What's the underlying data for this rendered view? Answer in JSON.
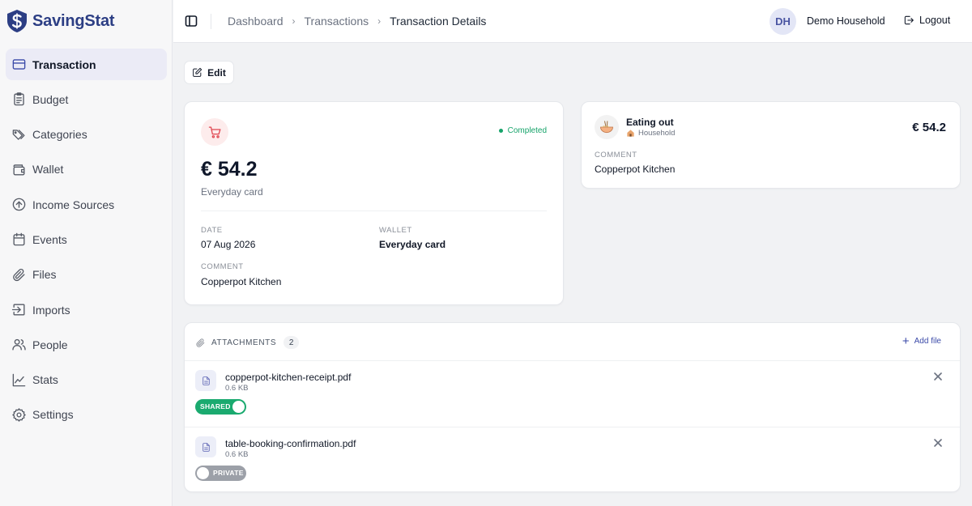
{
  "app": {
    "name": "SavingStat",
    "brand_color": "#2c3e84",
    "accent_color": "#3b4aa8"
  },
  "sidebar": {
    "items": [
      {
        "label": "Transaction",
        "icon": "credit-card-icon",
        "active": true
      },
      {
        "label": "Budget",
        "icon": "clipboard-icon"
      },
      {
        "label": "Categories",
        "icon": "tags-icon"
      },
      {
        "label": "Wallet",
        "icon": "wallet-icon"
      },
      {
        "label": "Income Sources",
        "icon": "arrow-up-circle-icon"
      },
      {
        "label": "Events",
        "icon": "calendar-icon"
      },
      {
        "label": "Files",
        "icon": "paperclip-icon"
      },
      {
        "label": "Imports",
        "icon": "import-icon"
      },
      {
        "label": "People",
        "icon": "users-icon"
      },
      {
        "label": "Stats",
        "icon": "chart-line-icon"
      },
      {
        "label": "Settings",
        "icon": "gear-icon"
      }
    ]
  },
  "header": {
    "breadcrumb": [
      "Dashboard",
      "Transactions",
      "Transaction Details"
    ],
    "avatar_initials": "DH",
    "household": "Demo Household",
    "logout_label": "Logout"
  },
  "toolbar": {
    "edit_label": "Edit"
  },
  "transaction": {
    "status": "Completed",
    "status_color": "#16a36a",
    "amount": "€ 54.2",
    "wallet_sub": "Everyday card",
    "date_label": "DATE",
    "date": "07 Aug 2026",
    "wallet_label": "WALLET",
    "wallet": "Everyday card",
    "comment_label": "COMMENT",
    "comment": "Copperpot Kitchen"
  },
  "category": {
    "name": "Eating out",
    "group": "Household",
    "amount": "€ 54.2",
    "comment_label": "COMMENT",
    "comment": "Copperpot Kitchen"
  },
  "attachments": {
    "title": "ATTACHMENTS",
    "count": "2",
    "add_label": "Add file",
    "files": [
      {
        "name": "copperpot-kitchen-receipt.pdf",
        "size": "0.6 KB",
        "visibility": "SHARED",
        "shared": true
      },
      {
        "name": "table-booking-confirmation.pdf",
        "size": "0.6 KB",
        "visibility": "PRIVATE",
        "shared": false
      }
    ]
  }
}
